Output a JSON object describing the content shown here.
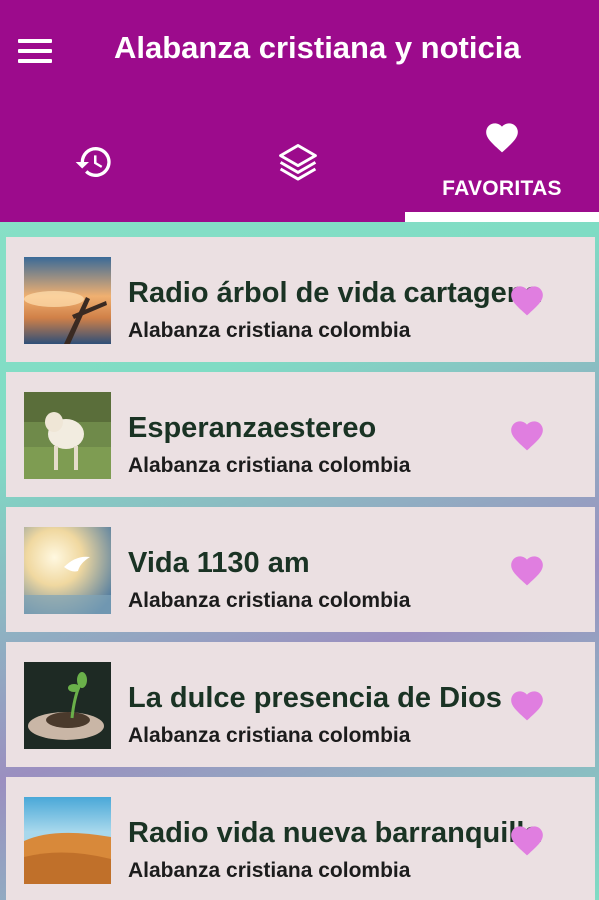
{
  "app": {
    "title": "Alabanza cristiana y noticia",
    "colors": {
      "header": "#9c0b8c",
      "card": "#ebe0e2",
      "heart": "#e07ee0",
      "text": "#1a3324"
    }
  },
  "tabs": [
    {
      "icon": "history-icon",
      "label": ""
    },
    {
      "icon": "layers-icon",
      "label": ""
    },
    {
      "icon": "heart-icon",
      "label": "FAVORITAS",
      "selected": true
    }
  ],
  "stations": [
    {
      "title": "Radio árbol de vida  cartagena",
      "subtitle": "Alabanza cristiana colombia",
      "image": "sunset-cross"
    },
    {
      "title": "Esperanzaestereo",
      "subtitle": "Alabanza cristiana colombia",
      "image": "lamb"
    },
    {
      "title": "Vida 1130 am",
      "subtitle": "Alabanza cristiana colombia",
      "image": "dove-light"
    },
    {
      "title": "La dulce presencia de Dios",
      "subtitle": "Alabanza cristiana colombia",
      "image": "sprout-hands"
    },
    {
      "title": "Radio vida nueva barranquilla",
      "subtitle": "Alabanza cristiana colombia",
      "image": "desert-dunes"
    }
  ]
}
